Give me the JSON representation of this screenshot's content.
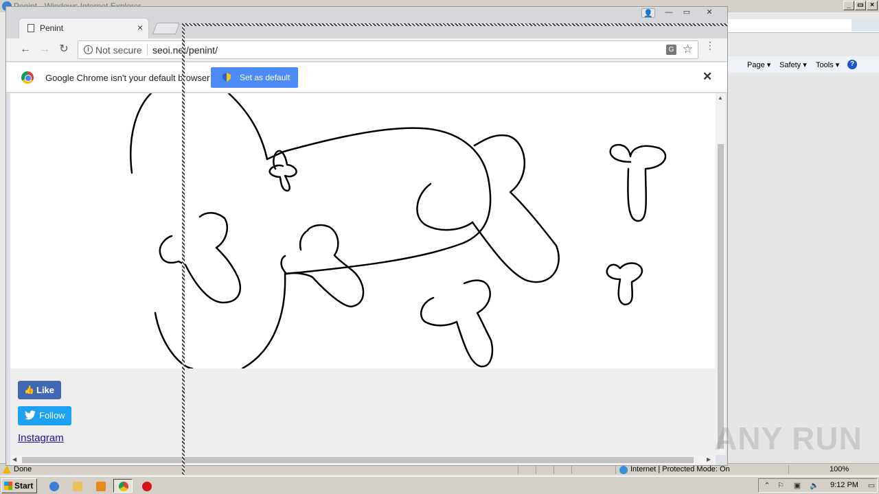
{
  "ie": {
    "title": "Penint - Windows Internet Explorer",
    "commands": [
      "Page ▾",
      "Safety ▾",
      "Tools ▾"
    ],
    "help_glyph": "?",
    "status_text": "Done",
    "zone_text": "Internet | Protected Mode: On",
    "zoom_text": "100%"
  },
  "chrome": {
    "tab_title": "Penint",
    "tab_close": "×",
    "security_label": "Not secure",
    "url": "seoi.net/penint/",
    "info_glyph": "i",
    "infobar_message": "Google Chrome isn't your default browser",
    "set_default_label": "Set as default",
    "infobar_close": "✕",
    "back": "←",
    "forward": "→",
    "reload": "↻",
    "star": "☆",
    "menu": "⋮",
    "translate": "G",
    "profile": "👤",
    "minimize": "—",
    "maximize": "▭",
    "close": "✕"
  },
  "page": {
    "like_label": "Like",
    "follow_label": "Follow",
    "instagram_label": "Instagram"
  },
  "watermark": "ANY RUN",
  "taskbar": {
    "start_label": "Start",
    "clock": "9:12 PM"
  },
  "colors": {
    "facebook": "#4267b2",
    "twitter": "#1da1f2",
    "chrome_button": "#4c8bf5"
  }
}
